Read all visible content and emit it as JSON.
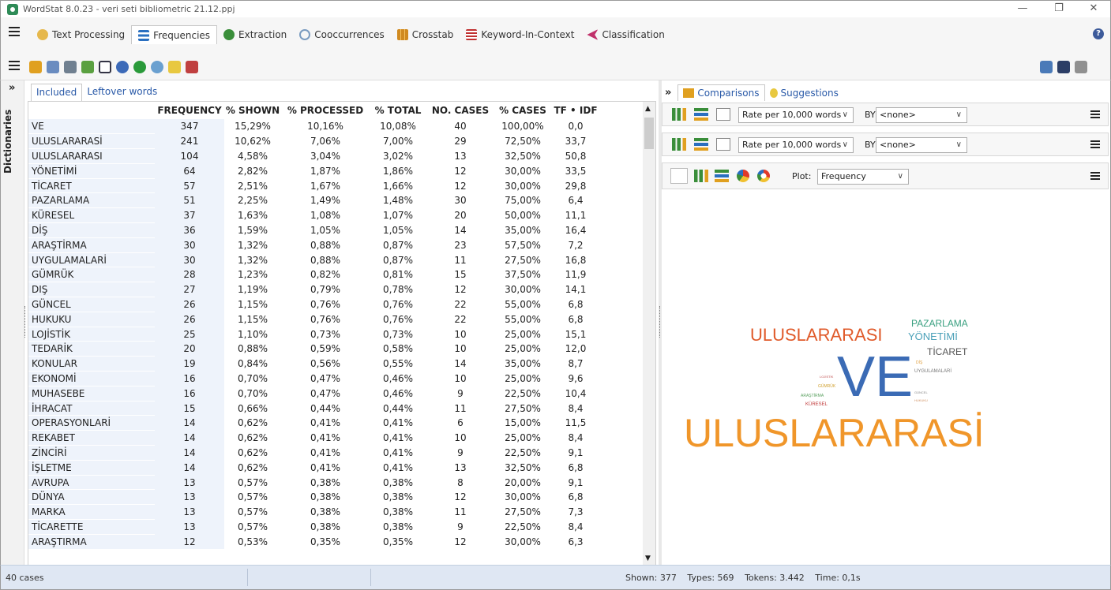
{
  "window": {
    "title": "WordStat 8.0.23 - veri seti bibliometric 21.12.ppj"
  },
  "menu": {
    "tabs": [
      {
        "label": "Text Processing",
        "icon": "text-processing-icon",
        "color": "#e6b84c"
      },
      {
        "label": "Frequencies",
        "icon": "frequencies-icon",
        "color": "#2a6fc0"
      },
      {
        "label": "Extraction",
        "icon": "extraction-icon",
        "color": "#3a8e3a"
      },
      {
        "label": "Cooccurrences",
        "icon": "cooccurrences-icon",
        "color": "#7a9bc0"
      },
      {
        "label": "Crosstab",
        "icon": "crosstab-icon",
        "color": "#d08a20"
      },
      {
        "label": "Keyword-In-Context",
        "icon": "kwic-icon",
        "color": "#c03030"
      },
      {
        "label": "Classification",
        "icon": "classification-icon",
        "color": "#c0306a"
      }
    ]
  },
  "left": {
    "vertical_label": "Dictionaries",
    "tabs": [
      "Included",
      "Leftover words"
    ],
    "columns": [
      "FREQUENCY",
      "% SHOWN",
      "% PROCESSED",
      "% TOTAL",
      "NO. CASES",
      "% CASES",
      "TF • IDF"
    ],
    "rows": [
      [
        "VE",
        "347",
        "15,29%",
        "10,16%",
        "10,08%",
        "40",
        "100,00%",
        "0,0"
      ],
      [
        "ULUSLARARASİ",
        "241",
        "10,62%",
        "7,06%",
        "7,00%",
        "29",
        "72,50%",
        "33,7"
      ],
      [
        "ULUSLARARASI",
        "104",
        "4,58%",
        "3,04%",
        "3,02%",
        "13",
        "32,50%",
        "50,8"
      ],
      [
        "YÖNETİMİ",
        "64",
        "2,82%",
        "1,87%",
        "1,86%",
        "12",
        "30,00%",
        "33,5"
      ],
      [
        "TİCARET",
        "57",
        "2,51%",
        "1,67%",
        "1,66%",
        "12",
        "30,00%",
        "29,8"
      ],
      [
        "PAZARLAMA",
        "51",
        "2,25%",
        "1,49%",
        "1,48%",
        "30",
        "75,00%",
        "6,4"
      ],
      [
        "KÜRESEL",
        "37",
        "1,63%",
        "1,08%",
        "1,07%",
        "20",
        "50,00%",
        "11,1"
      ],
      [
        "DİŞ",
        "36",
        "1,59%",
        "1,05%",
        "1,05%",
        "14",
        "35,00%",
        "16,4"
      ],
      [
        "ARAŞTİRMA",
        "30",
        "1,32%",
        "0,88%",
        "0,87%",
        "23",
        "57,50%",
        "7,2"
      ],
      [
        "UYGULAMALARİ",
        "30",
        "1,32%",
        "0,88%",
        "0,87%",
        "11",
        "27,50%",
        "16,8"
      ],
      [
        "GÜMRÜK",
        "28",
        "1,23%",
        "0,82%",
        "0,81%",
        "15",
        "37,50%",
        "11,9"
      ],
      [
        "DIŞ",
        "27",
        "1,19%",
        "0,79%",
        "0,78%",
        "12",
        "30,00%",
        "14,1"
      ],
      [
        "GÜNCEL",
        "26",
        "1,15%",
        "0,76%",
        "0,76%",
        "22",
        "55,00%",
        "6,8"
      ],
      [
        "HUKUKU",
        "26",
        "1,15%",
        "0,76%",
        "0,76%",
        "22",
        "55,00%",
        "6,8"
      ],
      [
        "LOJİSTİK",
        "25",
        "1,10%",
        "0,73%",
        "0,73%",
        "10",
        "25,00%",
        "15,1"
      ],
      [
        "TEDARİK",
        "20",
        "0,88%",
        "0,59%",
        "0,58%",
        "10",
        "25,00%",
        "12,0"
      ],
      [
        "KONULAR",
        "19",
        "0,84%",
        "0,56%",
        "0,55%",
        "14",
        "35,00%",
        "8,7"
      ],
      [
        "EKONOMİ",
        "16",
        "0,70%",
        "0,47%",
        "0,46%",
        "10",
        "25,00%",
        "9,6"
      ],
      [
        "MUHASEBE",
        "16",
        "0,70%",
        "0,47%",
        "0,46%",
        "9",
        "22,50%",
        "10,4"
      ],
      [
        "İHRACAT",
        "15",
        "0,66%",
        "0,44%",
        "0,44%",
        "11",
        "27,50%",
        "8,4"
      ],
      [
        "OPERASYONLARİ",
        "14",
        "0,62%",
        "0,41%",
        "0,41%",
        "6",
        "15,00%",
        "11,5"
      ],
      [
        "REKABET",
        "14",
        "0,62%",
        "0,41%",
        "0,41%",
        "10",
        "25,00%",
        "8,4"
      ],
      [
        "ZİNCİRİ",
        "14",
        "0,62%",
        "0,41%",
        "0,41%",
        "9",
        "22,50%",
        "9,1"
      ],
      [
        "İŞLETME",
        "14",
        "0,62%",
        "0,41%",
        "0,41%",
        "13",
        "32,50%",
        "6,8"
      ],
      [
        "AVRUPA",
        "13",
        "0,57%",
        "0,38%",
        "0,38%",
        "8",
        "20,00%",
        "9,1"
      ],
      [
        "DÜNYA",
        "13",
        "0,57%",
        "0,38%",
        "0,38%",
        "12",
        "30,00%",
        "6,8"
      ],
      [
        "MARKA",
        "13",
        "0,57%",
        "0,38%",
        "0,38%",
        "11",
        "27,50%",
        "7,3"
      ],
      [
        "TİCARETTE",
        "13",
        "0,57%",
        "0,38%",
        "0,38%",
        "9",
        "22,50%",
        "8,4"
      ],
      [
        "ARAŞTIRMA",
        "12",
        "0,53%",
        "0,35%",
        "0,35%",
        "12",
        "30,00%",
        "6,3"
      ]
    ]
  },
  "right": {
    "tabs": [
      "Comparisons",
      "Suggestions"
    ],
    "bar1": {
      "rate": "Rate per 10,000 words",
      "by_label": "BY",
      "by_value": "<none>"
    },
    "bar2": {
      "rate": "Rate per 10,000 words",
      "by_label": "BY",
      "by_value": "<none>"
    },
    "bar3": {
      "wordcloud_icon_label": "Word Cloud",
      "plot_label": "Plot:",
      "plot_value": "Frequency"
    },
    "cloud": {
      "words": [
        {
          "text": "VE",
          "color": "#3b6bb5"
        },
        {
          "text": "ULUSLARARASİ",
          "color": "#f0962a"
        },
        {
          "text": "ULUSLARARASI",
          "color": "#e05a2a"
        },
        {
          "text": "YÖNETİMİ",
          "color": "#4aa0b8"
        },
        {
          "text": "PAZARLAMA",
          "color": "#3aa080"
        },
        {
          "text": "TİCARET",
          "color": "#555555"
        },
        {
          "text": "UYGULAMALARİ",
          "color": "#777777"
        },
        {
          "text": "KÜRESEL",
          "color": "#c03a3a"
        },
        {
          "text": "ARAŞTİRMA",
          "color": "#5aa060"
        },
        {
          "text": "GÜMRÜK",
          "color": "#d0a030"
        },
        {
          "text": "LOJİSTİK",
          "color": "#c05050"
        },
        {
          "text": "GÜNCEL",
          "color": "#888888"
        },
        {
          "text": "DİŞ",
          "color": "#e0a040"
        },
        {
          "text": "HUKUKU",
          "color": "#d09060"
        }
      ]
    }
  },
  "status": {
    "cases": "40 cases",
    "shown": "Shown: 377",
    "types": "Types: 569",
    "tokens": "Tokens: 3.442",
    "time": "Time: 0,1s"
  }
}
